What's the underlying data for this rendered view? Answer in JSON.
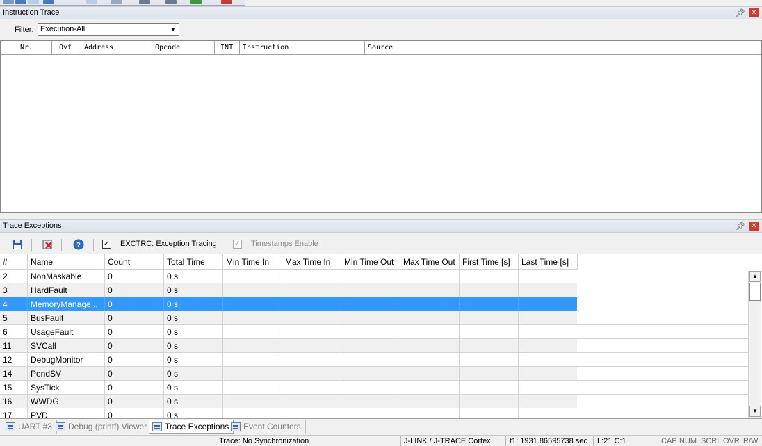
{
  "colors": {
    "selection": "#3399ff",
    "close": "#d23a2a",
    "panel_title_bg": "#e3e8ef"
  },
  "instruction_trace": {
    "title": "Instruction Trace",
    "filter_label": "Filter:",
    "filter_value": "Execution-All",
    "columns": [
      "Nr.",
      "Ovf",
      "Address",
      "Opcode",
      "INT",
      "Instruction",
      "Source"
    ]
  },
  "trace_exceptions": {
    "title": "Trace Exceptions",
    "toolbar": {
      "save_icon": "save-icon",
      "clear_icon": "delete-icon",
      "help_icon": "help-icon",
      "exctrc_checked": true,
      "exctrc_label": "EXCTRC: Exception Tracing",
      "timestamps_checked": true,
      "timestamps_label": "Timestamps Enable"
    },
    "columns": [
      "#",
      "Name",
      "Count",
      "Total Time",
      "Min Time In",
      "Max Time In",
      "Min Time Out",
      "Max Time Out",
      "First Time [s]",
      "Last Time [s]"
    ],
    "rows": [
      {
        "num": "2",
        "name": "NonMaskable",
        "count": "0",
        "total": "0 s"
      },
      {
        "num": "3",
        "name": "HardFault",
        "count": "0",
        "total": "0 s"
      },
      {
        "num": "4",
        "name": "MemoryManage...",
        "count": "0",
        "total": "0 s",
        "selected": true
      },
      {
        "num": "5",
        "name": "BusFault",
        "count": "0",
        "total": "0 s"
      },
      {
        "num": "6",
        "name": "UsageFault",
        "count": "0",
        "total": "0 s"
      },
      {
        "num": "11",
        "name": "SVCall",
        "count": "0",
        "total": "0 s"
      },
      {
        "num": "12",
        "name": "DebugMonitor",
        "count": "0",
        "total": "0 s"
      },
      {
        "num": "14",
        "name": "PendSV",
        "count": "0",
        "total": "0 s"
      },
      {
        "num": "15",
        "name": "SysTick",
        "count": "0",
        "total": "0 s"
      },
      {
        "num": "16",
        "name": "WWDG",
        "count": "0",
        "total": "0 s"
      },
      {
        "num": "17",
        "name": "PVD",
        "count": "0",
        "total": "0 s"
      }
    ]
  },
  "tabs": [
    {
      "label": "UART #3",
      "active": false
    },
    {
      "label": "Debug (printf) Viewer",
      "active": false
    },
    {
      "label": "Trace Exceptions",
      "active": true
    },
    {
      "label": "Event Counters",
      "active": false
    }
  ],
  "status": {
    "trace": "Trace: No Synchronization",
    "debugger": "J-LINK / J-TRACE Cortex",
    "time": "t1: 1931.86595738 sec",
    "position": "L:21 C:1",
    "cap": "CAP",
    "num": "NUM",
    "scrl": "SCRL",
    "ovr": "OVR",
    "rw": "R/W"
  }
}
